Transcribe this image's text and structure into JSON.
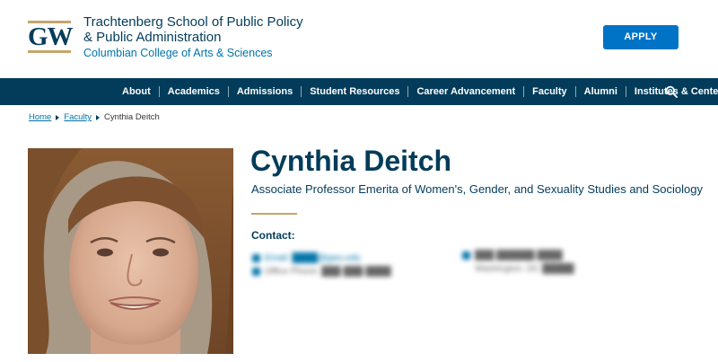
{
  "header": {
    "logo_text": "GW",
    "school_line1": "Trachtenberg School of Public Policy",
    "school_line2": "& Public Administration",
    "college": "Columbian College of Arts & Sciences",
    "apply_label": "APPLY"
  },
  "nav": {
    "items": [
      {
        "label": "About"
      },
      {
        "label": "Academics"
      },
      {
        "label": "Admissions"
      },
      {
        "label": "Student Resources"
      },
      {
        "label": "Career Advancement"
      },
      {
        "label": "Faculty"
      },
      {
        "label": "Alumni"
      },
      {
        "label": "Institutes & Centers"
      }
    ],
    "search_icon": "search-icon"
  },
  "breadcrumb": {
    "home": "Home",
    "faculty": "Faculty",
    "current": "Cynthia Deitch"
  },
  "profile": {
    "name": "Cynthia Deitch",
    "title": "Associate Professor Emerita of Women's, Gender, and Sexuality Studies and Sociology",
    "contact_label": "Contact:",
    "contact_left": [
      "Email: ████@gwu.edu",
      "Office Phone: ███-███-████"
    ],
    "contact_right": [
      "███ ██████ ████",
      "Washington, DC █████"
    ]
  },
  "colors": {
    "brand_navy": "#033c5a",
    "accent_buff": "#c5a56b",
    "link_blue": "#0073aa",
    "button_blue": "#0073c7"
  }
}
